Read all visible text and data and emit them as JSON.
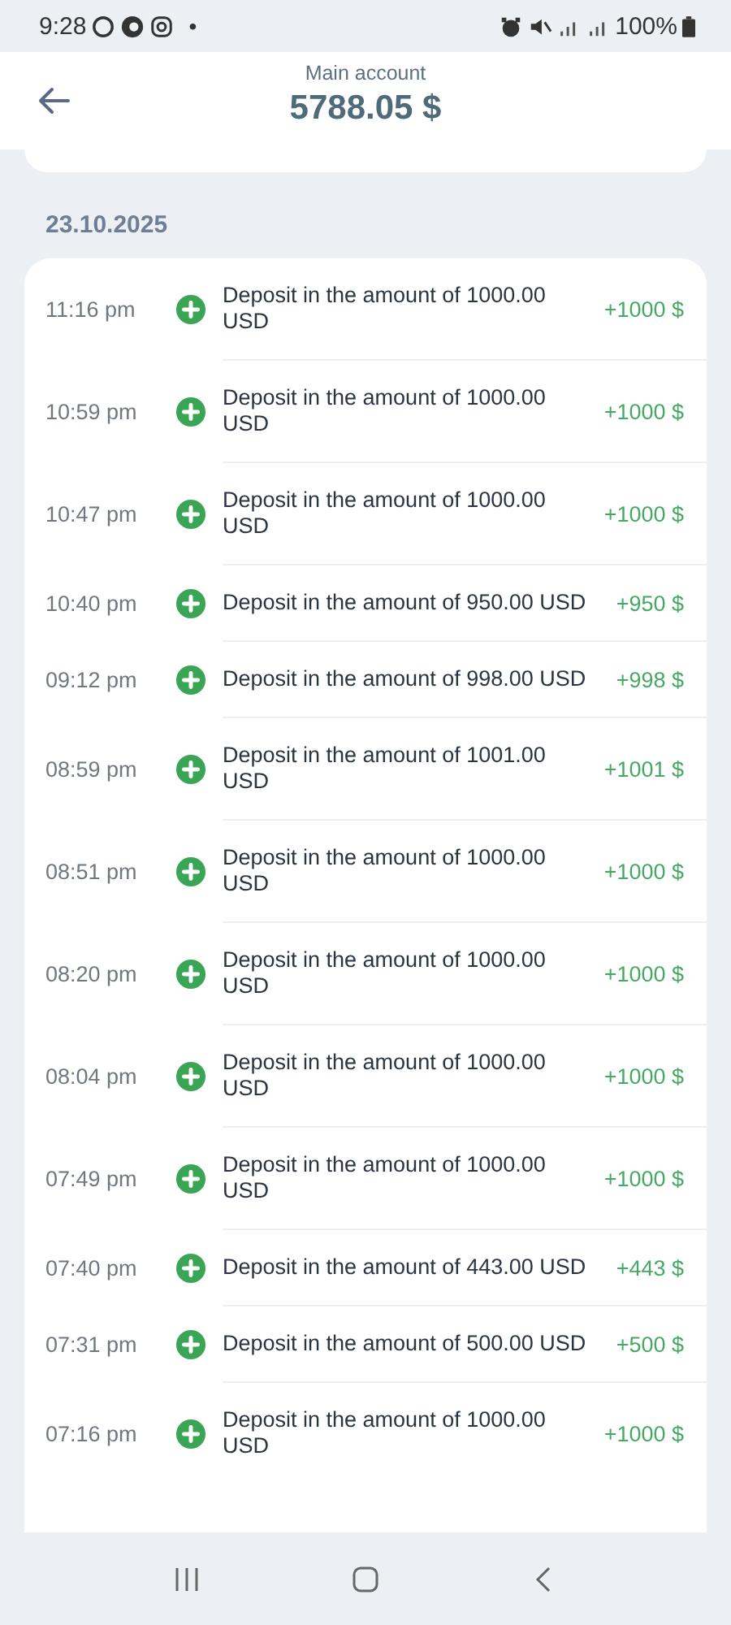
{
  "status_bar": {
    "time": "9:28",
    "dot": "•",
    "battery": "100%"
  },
  "header": {
    "title": "Main account",
    "balance": "5788.05 $"
  },
  "date": "23.10.2025",
  "transactions": [
    {
      "time": "11:16 pm",
      "description": "Deposit in the amount of 1000.00 USD",
      "amount": "+1000 $"
    },
    {
      "time": "10:59 pm",
      "description": "Deposit in the amount of 1000.00 USD",
      "amount": "+1000 $"
    },
    {
      "time": "10:47 pm",
      "description": "Deposit in the amount of 1000.00 USD",
      "amount": "+1000 $"
    },
    {
      "time": "10:40 pm",
      "description": "Deposit in the amount of 950.00 USD",
      "amount": "+950 $"
    },
    {
      "time": "09:12 pm",
      "description": "Deposit in the amount of 998.00 USD",
      "amount": "+998 $"
    },
    {
      "time": "08:59 pm",
      "description": "Deposit in the amount of 1001.00 USD",
      "amount": "+1001 $"
    },
    {
      "time": "08:51 pm",
      "description": "Deposit in the amount of 1000.00 USD",
      "amount": "+1000 $"
    },
    {
      "time": "08:20 pm",
      "description": "Deposit in the amount of 1000.00 USD",
      "amount": "+1000 $"
    },
    {
      "time": "08:04 pm",
      "description": "Deposit in the amount of 1000.00 USD",
      "amount": "+1000 $"
    },
    {
      "time": "07:49 pm",
      "description": "Deposit in the amount of 1000.00 USD",
      "amount": "+1000 $"
    },
    {
      "time": "07:40 pm",
      "description": "Deposit in the amount of 443.00 USD",
      "amount": "+443 $"
    },
    {
      "time": "07:31 pm",
      "description": "Deposit in the amount of 500.00 USD",
      "amount": "+500 $"
    },
    {
      "time": "07:16 pm",
      "description": "Deposit in the amount of 1000.00 USD",
      "amount": "+1000 $"
    }
  ]
}
